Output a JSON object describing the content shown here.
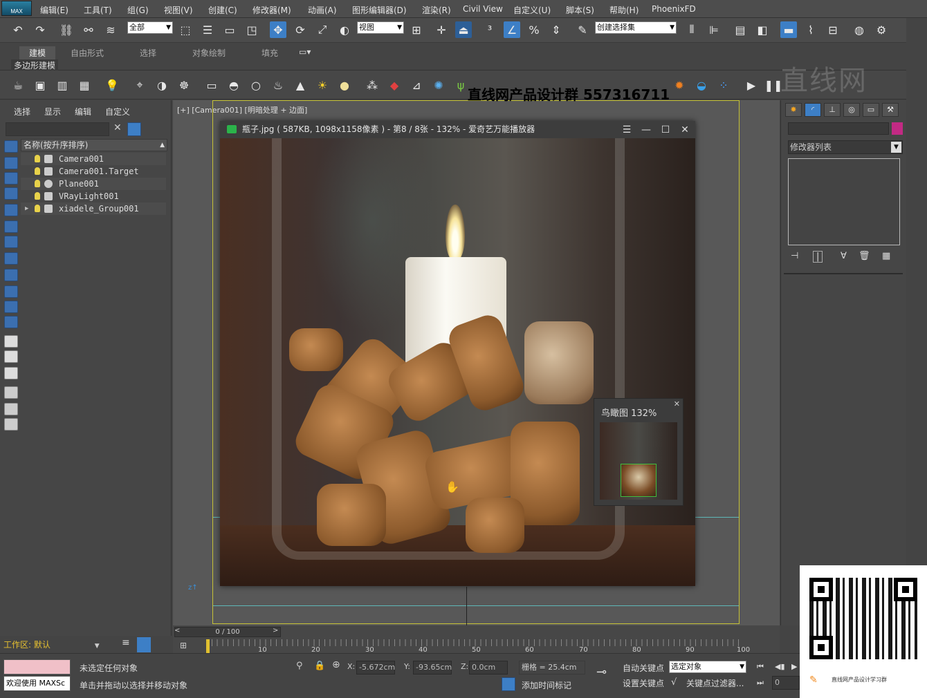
{
  "app": {
    "logo": "MAX",
    "menus": [
      "编辑(E)",
      "工具(T)",
      "组(G)",
      "视图(V)",
      "创建(C)",
      "修改器(M)",
      "动画(A)",
      "图形编辑器(D)",
      "渲染(R)",
      "Civil View",
      "自定义(U)",
      "脚本(S)",
      "帮助(H)",
      "PhoenixFD"
    ]
  },
  "toolbar": {
    "selection_filter": "全部",
    "ref_coord": "视图",
    "named_selection": "创建选择集"
  },
  "ribbon": {
    "tabs": [
      "建模",
      "自由形式",
      "选择",
      "对象绘制",
      "填充"
    ],
    "active_tab": "建模",
    "sub_label": "多边形建模"
  },
  "scene_explorer": {
    "tabs": [
      "选择",
      "显示",
      "编辑",
      "自定义"
    ],
    "column_header": "名称(按升序排序)",
    "items": [
      {
        "name": "Camera001"
      },
      {
        "name": "Camera001.Target"
      },
      {
        "name": "Plane001"
      },
      {
        "name": "VRayLight001"
      },
      {
        "name": "xiadele_Group001"
      }
    ]
  },
  "viewport": {
    "label": "[+] [Camera001] [明暗处理 + 边面]"
  },
  "image_viewer": {
    "title": "瓶子.jpg ( 587KB, 1098x1158像素 ) - 第8 / 8张 - 132% - 爱奇艺万能播放器",
    "zoom_percent": 132
  },
  "navigator": {
    "title": "鸟瞰图",
    "zoom": "132%"
  },
  "command_panel": {
    "modifier_list": "修改器列表",
    "object_color": "#c22a84"
  },
  "timeline": {
    "frame_display": "0 / 100",
    "ticks": [
      "10",
      "20",
      "30",
      "40",
      "50",
      "60",
      "70",
      "80",
      "90",
      "100"
    ]
  },
  "status": {
    "workspace": "工作区: 默认",
    "welcome": "欢迎使用 MAXSc",
    "selection_status": "未选定任何对象",
    "hint": "单击并拖动以选择并移动对象",
    "x_label": "X:",
    "x_value": "-5.672cm",
    "y_label": "Y:",
    "y_value": "-93.65cm",
    "z_label": "Z:",
    "z_value": "0.0cm",
    "grid": "栅格 = 25.4cm",
    "add_time_tag": "添加时间标记",
    "auto_key": "自动关键点",
    "set_key": "设置关键点",
    "key_target": "选定对象",
    "key_filter": "关键点过滤器...",
    "frame_field": "0"
  },
  "watermark": {
    "group_text": "直线网产品设计群 557316711",
    "brand": "直线网",
    "qr_caption": "直线网产品设计学习群"
  }
}
